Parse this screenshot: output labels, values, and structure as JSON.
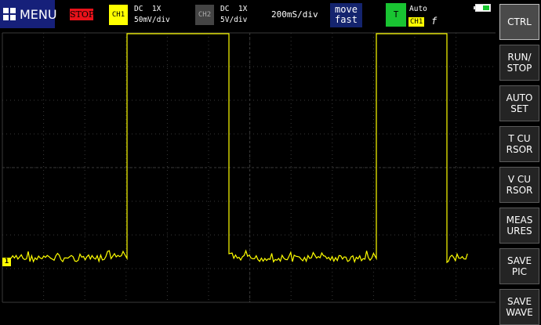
{
  "topbar": {
    "menu_label": "MENU",
    "run_state": "STOP",
    "ch1": {
      "label": "CH1",
      "coupling": "DC  1X",
      "scale": "50mV/div",
      "color": "#ffff00"
    },
    "ch2": {
      "label": "CH2",
      "coupling": "DC  1X",
      "scale": "5V/div",
      "color": "#444444"
    },
    "timebase": "200mS/div",
    "move_line1": "move",
    "move_line2": "fast",
    "trigger_label": "T",
    "trigger_mode": "Auto",
    "trigger_source": "CH1",
    "trigger_edge": "f",
    "battery_icon": "battery-icon"
  },
  "side_buttons": [
    {
      "label": "CTRL"
    },
    {
      "label": "RUN/\nSTOP"
    },
    {
      "label": "AUTO\nSET"
    },
    {
      "label": "T CU\nRSOR"
    },
    {
      "label": "V CU\nRSOR"
    },
    {
      "label": "MEAS\nURES"
    },
    {
      "label": "SAVE\nPIC"
    },
    {
      "label": "SAVE\nWAVE"
    }
  ],
  "scope": {
    "ch1_marker": "1",
    "trace_color": "#ffff00",
    "grid_color": "#3a3a3a"
  }
}
